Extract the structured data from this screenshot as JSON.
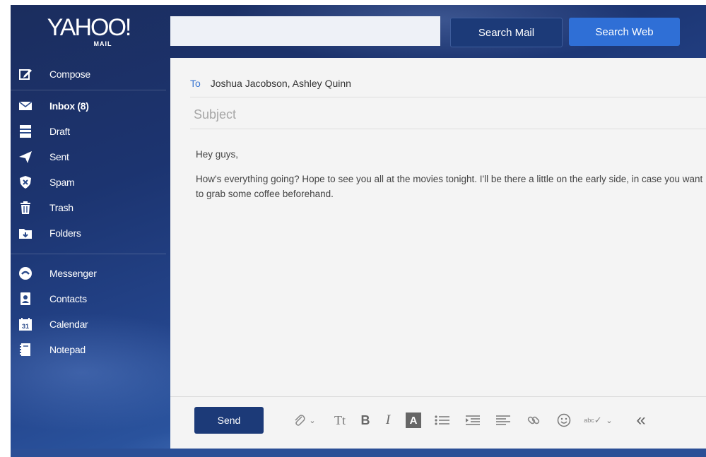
{
  "logo": {
    "brand": "YAHOO!",
    "sub": "MAIL"
  },
  "header": {
    "search_placeholder": "",
    "search_mail_label": "Search Mail",
    "search_web_label": "Search Web"
  },
  "sidebar": {
    "items": [
      {
        "label": "Compose",
        "icon": "compose-icon"
      },
      {
        "label": "Inbox (8)",
        "icon": "envelope-icon"
      },
      {
        "label": "Draft",
        "icon": "draft-icon"
      },
      {
        "label": "Sent",
        "icon": "paper-plane-icon"
      },
      {
        "label": "Spam",
        "icon": "spam-shield-icon"
      },
      {
        "label": "Trash",
        "icon": "trash-icon"
      },
      {
        "label": "Folders",
        "icon": "folder-icon"
      },
      {
        "label": "Messenger",
        "icon": "messenger-icon"
      },
      {
        "label": "Contacts",
        "icon": "contacts-icon"
      },
      {
        "label": "Calendar",
        "icon": "calendar-icon"
      },
      {
        "label": "Notepad",
        "icon": "notepad-icon"
      }
    ],
    "calendar_day": "31"
  },
  "compose": {
    "to_label": "To",
    "recipients": "Joshua Jacobson, Ashley Quinn",
    "subject_placeholder": "Subject",
    "body": [
      "Hey guys,",
      "How's everything going? Hope to see you all at the movies tonight. I'll be there a little on the early side, in case you want to grab some coffee beforehand."
    ],
    "send_label": "Send"
  },
  "toolbar": {
    "text_size_label": "Tt",
    "bold_label": "B",
    "italic_label": "I",
    "color_label": "A",
    "spell_label": "abc",
    "collapse_label": "«"
  },
  "colors": {
    "primary_button": "#1c3a78",
    "web_button": "#2f6fd6",
    "to_label": "#3a76d2"
  }
}
